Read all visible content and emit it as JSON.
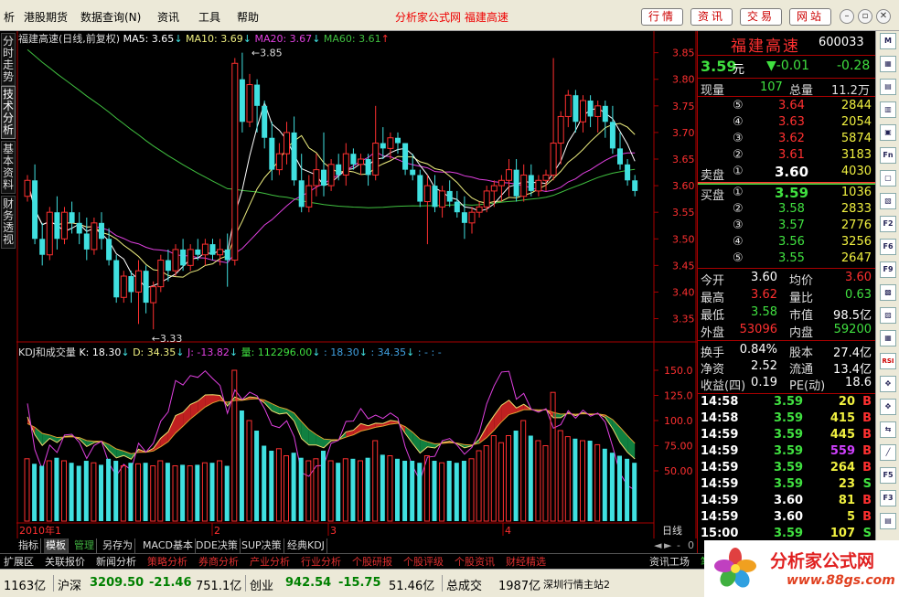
{
  "menubar": {
    "items": [
      "析",
      "港股期货",
      "数据查询(N)",
      "资讯",
      "工具",
      "帮助"
    ],
    "title": "分析家公式网  福建高速",
    "buttons": [
      "行情",
      "资讯",
      "交易",
      "网站"
    ]
  },
  "left_tabs": [
    "分时走势",
    "技术分析",
    "基本资料",
    "财务透视"
  ],
  "main_chart": {
    "legend": {
      "name": "福建高速(日线,前复权)",
      "ma5": "MA5: 3.65",
      "ma10": "MA10: 3.69",
      "ma20": "MA20: 3.67",
      "ma60": "MA60: 3.61"
    },
    "y_ticks": [
      "3.85",
      "3.80",
      "3.75",
      "3.70",
      "3.65",
      "3.60",
      "3.55",
      "3.50",
      "3.45",
      "3.40",
      "3.35"
    ],
    "high_label": "3.85",
    "low_label": "3.33"
  },
  "indicator": {
    "legend": {
      "name": "KDJ和成交量",
      "k": "K: 18.30",
      "d": "D: 34.35",
      "j": "J: -13.82",
      "vol": "量: 112296.00",
      "k2": ": 18.30",
      "d2": ": 34.35",
      "extra": ": - : -"
    },
    "y_ticks": [
      "150.0",
      "125.0",
      "100.0",
      "75.00",
      "50.00"
    ]
  },
  "x_axis": {
    "labels": [
      "2010年1",
      "2",
      "3",
      "4"
    ],
    "period": "日线"
  },
  "colors": {
    "up": "#ff3030",
    "down": "#40e0e0",
    "ma5": "#ffffff",
    "ma10": "#f0f080",
    "ma20": "#e040e0",
    "ma60": "#40c040"
  },
  "chart_data": {
    "type": "candlestick",
    "title": "福建高速(日线,前复权)",
    "ylim": [
      3.32,
      3.87
    ],
    "ohlc": [
      [
        3.58,
        3.62,
        3.57,
        3.61
      ],
      [
        3.61,
        3.64,
        3.49,
        3.5
      ],
      [
        3.5,
        3.53,
        3.45,
        3.47
      ],
      [
        3.47,
        3.56,
        3.46,
        3.55
      ],
      [
        3.55,
        3.58,
        3.48,
        3.5
      ],
      [
        3.5,
        3.56,
        3.49,
        3.55
      ],
      [
        3.55,
        3.57,
        3.51,
        3.53
      ],
      [
        3.53,
        3.55,
        3.49,
        3.51
      ],
      [
        3.51,
        3.54,
        3.46,
        3.48
      ],
      [
        3.48,
        3.54,
        3.47,
        3.53
      ],
      [
        3.53,
        3.55,
        3.48,
        3.5
      ],
      [
        3.5,
        3.52,
        3.45,
        3.46
      ],
      [
        3.46,
        3.47,
        3.38,
        3.39
      ],
      [
        3.39,
        3.44,
        3.38,
        3.43
      ],
      [
        3.43,
        3.44,
        3.38,
        3.4
      ],
      [
        3.4,
        3.46,
        3.34,
        3.44
      ],
      [
        3.44,
        3.45,
        3.36,
        3.38
      ],
      [
        3.38,
        3.42,
        3.33,
        3.41
      ],
      [
        3.41,
        3.47,
        3.4,
        3.46
      ],
      [
        3.46,
        3.48,
        3.42,
        3.44
      ],
      [
        3.44,
        3.49,
        3.43,
        3.48
      ],
      [
        3.48,
        3.5,
        3.44,
        3.45
      ],
      [
        3.45,
        3.49,
        3.44,
        3.48
      ],
      [
        3.48,
        3.5,
        3.46,
        3.47
      ],
      [
        3.47,
        3.5,
        3.45,
        3.49
      ],
      [
        3.49,
        3.5,
        3.46,
        3.47
      ],
      [
        3.47,
        3.5,
        3.45,
        3.48
      ],
      [
        3.48,
        3.51,
        3.41,
        3.46
      ],
      [
        3.46,
        3.84,
        3.45,
        3.83
      ],
      [
        3.8,
        3.85,
        3.7,
        3.72
      ],
      [
        3.72,
        3.81,
        3.71,
        3.79
      ],
      [
        3.79,
        3.8,
        3.7,
        3.75
      ],
      [
        3.75,
        3.76,
        3.67,
        3.69
      ],
      [
        3.69,
        3.72,
        3.61,
        3.63
      ],
      [
        3.63,
        3.68,
        3.62,
        3.66
      ],
      [
        3.66,
        3.72,
        3.64,
        3.7
      ],
      [
        3.7,
        3.73,
        3.6,
        3.61
      ],
      [
        3.61,
        3.66,
        3.55,
        3.56
      ],
      [
        3.56,
        3.62,
        3.55,
        3.6
      ],
      [
        3.6,
        3.66,
        3.58,
        3.63
      ],
      [
        3.63,
        3.7,
        3.58,
        3.6
      ],
      [
        3.6,
        3.65,
        3.59,
        3.64
      ],
      [
        3.64,
        3.66,
        3.61,
        3.62
      ],
      [
        3.62,
        3.68,
        3.6,
        3.66
      ],
      [
        3.66,
        3.67,
        3.63,
        3.64
      ],
      [
        3.64,
        3.66,
        3.62,
        3.65
      ],
      [
        3.65,
        3.66,
        3.6,
        3.62
      ],
      [
        3.62,
        3.75,
        3.61,
        3.68
      ],
      [
        3.68,
        3.71,
        3.65,
        3.67
      ],
      [
        3.67,
        3.7,
        3.65,
        3.69
      ],
      [
        3.69,
        3.7,
        3.66,
        3.68
      ],
      [
        3.68,
        3.68,
        3.62,
        3.63
      ],
      [
        3.63,
        3.66,
        3.61,
        3.62
      ],
      [
        3.62,
        3.63,
        3.56,
        3.57
      ],
      [
        3.57,
        3.62,
        3.49,
        3.6
      ],
      [
        3.6,
        3.62,
        3.55,
        3.56
      ],
      [
        3.56,
        3.6,
        3.54,
        3.59
      ],
      [
        3.59,
        3.61,
        3.56,
        3.57
      ],
      [
        3.57,
        3.59,
        3.54,
        3.55
      ],
      [
        3.55,
        3.58,
        3.5,
        3.53
      ],
      [
        3.53,
        3.56,
        3.51,
        3.55
      ],
      [
        3.55,
        3.57,
        3.54,
        3.56
      ],
      [
        3.56,
        3.6,
        3.55,
        3.59
      ],
      [
        3.59,
        3.61,
        3.56,
        3.6
      ],
      [
        3.6,
        3.62,
        3.57,
        3.61
      ],
      [
        3.61,
        3.65,
        3.58,
        3.63
      ],
      [
        3.63,
        3.65,
        3.57,
        3.58
      ],
      [
        3.58,
        3.64,
        3.57,
        3.62
      ],
      [
        3.62,
        3.64,
        3.58,
        3.59
      ],
      [
        3.59,
        3.62,
        3.58,
        3.61
      ],
      [
        3.61,
        3.63,
        3.59,
        3.62
      ],
      [
        3.62,
        3.84,
        3.61,
        3.68
      ],
      [
        3.68,
        3.74,
        3.64,
        3.73
      ],
      [
        3.73,
        3.78,
        3.71,
        3.77
      ],
      [
        3.77,
        3.78,
        3.7,
        3.72
      ],
      [
        3.72,
        3.77,
        3.7,
        3.76
      ],
      [
        3.76,
        3.77,
        3.71,
        3.73
      ],
      [
        3.73,
        3.76,
        3.7,
        3.75
      ],
      [
        3.75,
        3.76,
        3.69,
        3.72
      ],
      [
        3.72,
        3.75,
        3.66,
        3.67
      ],
      [
        3.67,
        3.7,
        3.63,
        3.64
      ],
      [
        3.64,
        3.65,
        3.6,
        3.61
      ],
      [
        3.61,
        3.62,
        3.58,
        3.59
      ]
    ],
    "volume_ylim": [
      0,
      160
    ],
    "volumes": [
      62,
      57,
      55,
      60,
      63,
      60,
      58,
      55,
      60,
      58,
      56,
      62,
      60,
      55,
      58,
      57,
      58,
      55,
      60,
      58,
      55,
      56,
      55,
      56,
      58,
      58,
      60,
      55,
      150,
      110,
      100,
      90,
      75,
      70,
      72,
      65,
      68,
      63,
      60,
      62,
      70,
      60,
      58,
      62,
      62,
      60,
      63,
      80,
      66,
      65,
      62,
      60,
      60,
      58,
      65,
      60,
      58,
      60,
      58,
      60,
      62,
      70,
      75,
      85,
      78,
      85,
      90,
      100,
      85,
      80,
      75,
      128,
      90,
      84,
      82,
      80,
      80,
      76,
      72,
      68,
      65,
      62,
      58
    ]
  },
  "right_panel": {
    "name": "福建高速",
    "code": "600033",
    "price": "3.59",
    "unit": "元",
    "change": "▼-0.01",
    "change_pct": "-0.28",
    "now_label": "现量",
    "now_vol": "107",
    "total_label": "总量",
    "total_vol": "11.2万",
    "sell_label": "卖盘",
    "buy_label": "买盘",
    "asks": [
      {
        "lvl": "⑤",
        "price": "3.64",
        "vol": "2844"
      },
      {
        "lvl": "④",
        "price": "3.63",
        "vol": "2054"
      },
      {
        "lvl": "③",
        "price": "3.62",
        "vol": "5874"
      },
      {
        "lvl": "②",
        "price": "3.61",
        "vol": "3183"
      },
      {
        "lvl": "①",
        "price": "3.60",
        "vol": "4030"
      }
    ],
    "bids": [
      {
        "lvl": "①",
        "price": "3.59",
        "vol": "1036"
      },
      {
        "lvl": "②",
        "price": "3.58",
        "vol": "2833"
      },
      {
        "lvl": "③",
        "price": "3.57",
        "vol": "2776"
      },
      {
        "lvl": "④",
        "price": "3.56",
        "vol": "3256"
      },
      {
        "lvl": "⑤",
        "price": "3.55",
        "vol": "2647"
      }
    ],
    "stats": [
      {
        "l1": "今开",
        "v1": "3.60",
        "l2": "均价",
        "v2": "3.60",
        "c1": "#ffffff",
        "c2": "#ff3030"
      },
      {
        "l1": "最高",
        "v1": "3.62",
        "l2": "量比",
        "v2": "0.63",
        "c1": "#ff3030",
        "c2": "#40e040"
      },
      {
        "l1": "最低",
        "v1": "3.58",
        "l2": "市值",
        "v2": "98.5亿",
        "c1": "#40e040",
        "c2": "#ffffff"
      },
      {
        "l1": "外盘",
        "v1": "53096",
        "l2": "内盘",
        "v2": "59200",
        "c1": "#ff3030",
        "c2": "#40e040"
      }
    ],
    "fin": [
      {
        "l1": "换手",
        "v1": "0.84%",
        "l2": "股本",
        "v2": "27.4亿"
      },
      {
        "l1": "净资",
        "v1": "2.52",
        "l2": "流通",
        "v2": "13.4亿"
      },
      {
        "l1": "收益(四)",
        "v1": "0.19",
        "l2": "PE(动)",
        "v2": "18.6"
      }
    ],
    "ticks": [
      {
        "time": "14:58",
        "price": "3.59",
        "vol": "20",
        "side": "B",
        "pc": "#40e040",
        "vc": "#f0f040"
      },
      {
        "time": "14:58",
        "price": "3.59",
        "vol": "415",
        "side": "B",
        "pc": "#40e040",
        "vc": "#f0f040"
      },
      {
        "time": "14:59",
        "price": "3.59",
        "vol": "445",
        "side": "B",
        "pc": "#40e040",
        "vc": "#f0f040"
      },
      {
        "time": "14:59",
        "price": "3.59",
        "vol": "559",
        "side": "B",
        "pc": "#40e040",
        "vc": "#d040ff"
      },
      {
        "time": "14:59",
        "price": "3.59",
        "vol": "264",
        "side": "B",
        "pc": "#40e040",
        "vc": "#f0f040"
      },
      {
        "time": "14:59",
        "price": "3.59",
        "vol": "23",
        "side": "S",
        "pc": "#40e040",
        "vc": "#f0f040"
      },
      {
        "time": "14:59",
        "price": "3.60",
        "vol": "81",
        "side": "B",
        "pc": "#ffffff",
        "vc": "#f0f040"
      },
      {
        "time": "14:59",
        "price": "3.60",
        "vol": "5",
        "side": "B",
        "pc": "#ffffff",
        "vc": "#f0f040"
      },
      {
        "time": "15:00",
        "price": "3.59",
        "vol": "107",
        "side": "S",
        "pc": "#40e040",
        "vc": "#f0f040"
      }
    ]
  },
  "bottom_tabs": [
    "指标",
    "模板",
    "管理",
    "另存为",
    "MACD基本",
    "DDE决策",
    "SUP决策",
    "经典KDJ"
  ],
  "scroll": {
    "left": "◄",
    "right": "►",
    "minus": "-",
    "zero": "0"
  },
  "funcbar": {
    "items": [
      "扩展区",
      "关联报价",
      "新闻分析",
      "策略分析",
      "券商分析",
      "产业分析",
      "行业分析",
      "个股研报",
      "个股评级",
      "个股资讯",
      "财经精选"
    ],
    "right": "资讯工场",
    "right2": "笔"
  },
  "statusbar": {
    "left_amt": "1163亿",
    "sh_label": "沪深",
    "sh_val": "3209.50",
    "sh_chg": "-21.46",
    "sh_amt": "751.1亿",
    "cy_label": "创业",
    "cy_val": "942.54",
    "cy_chg": "-15.75",
    "cy_amt": "51.46亿",
    "total_label": "总成交",
    "total_amt": "1987亿",
    "server": "深圳行情主站2"
  },
  "logo": {
    "text": "分析家公式网",
    "url": "www.88gs.com"
  },
  "toolbar": [
    "M",
    "▦",
    "▤",
    "▥",
    "▣",
    "Fn",
    "▢",
    "▧",
    "F2",
    "F6",
    "F9",
    "▩",
    "▨",
    "▦",
    "RSI",
    "✥",
    "✥",
    "⇆",
    "╱",
    "F5",
    "F3",
    "▤"
  ]
}
